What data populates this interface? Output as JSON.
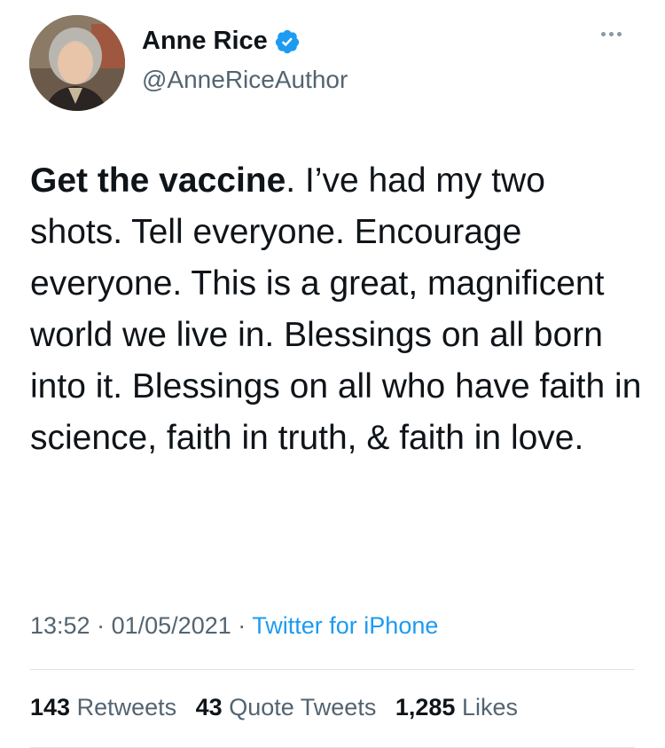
{
  "author": {
    "display_name": "Anne Rice",
    "handle": "@AnneRiceAuthor",
    "verified": true,
    "verified_color": "#1d9bf0"
  },
  "tweet": {
    "bold_text": "Get the vaccine",
    "text": ". I’ve had my two shots. Tell everyone. Encourage everyone. This is a great, magnificent world we live in. Blessings on all born into it. Blessings on all who have faith in science, faith in truth, & faith in love."
  },
  "meta": {
    "time": "13:52",
    "separator": "·",
    "date": "01/05/2021",
    "source": "Twitter for iPhone"
  },
  "stats": {
    "retweets_count": "143",
    "retweets_label": "Retweets",
    "quotes_count": "43",
    "quotes_label": "Quote Tweets",
    "likes_count": "1,285",
    "likes_label": "Likes"
  },
  "icons": {
    "avatar": "avatar-photo",
    "verified": "verified-badge-icon",
    "more": "more-options-icon"
  }
}
